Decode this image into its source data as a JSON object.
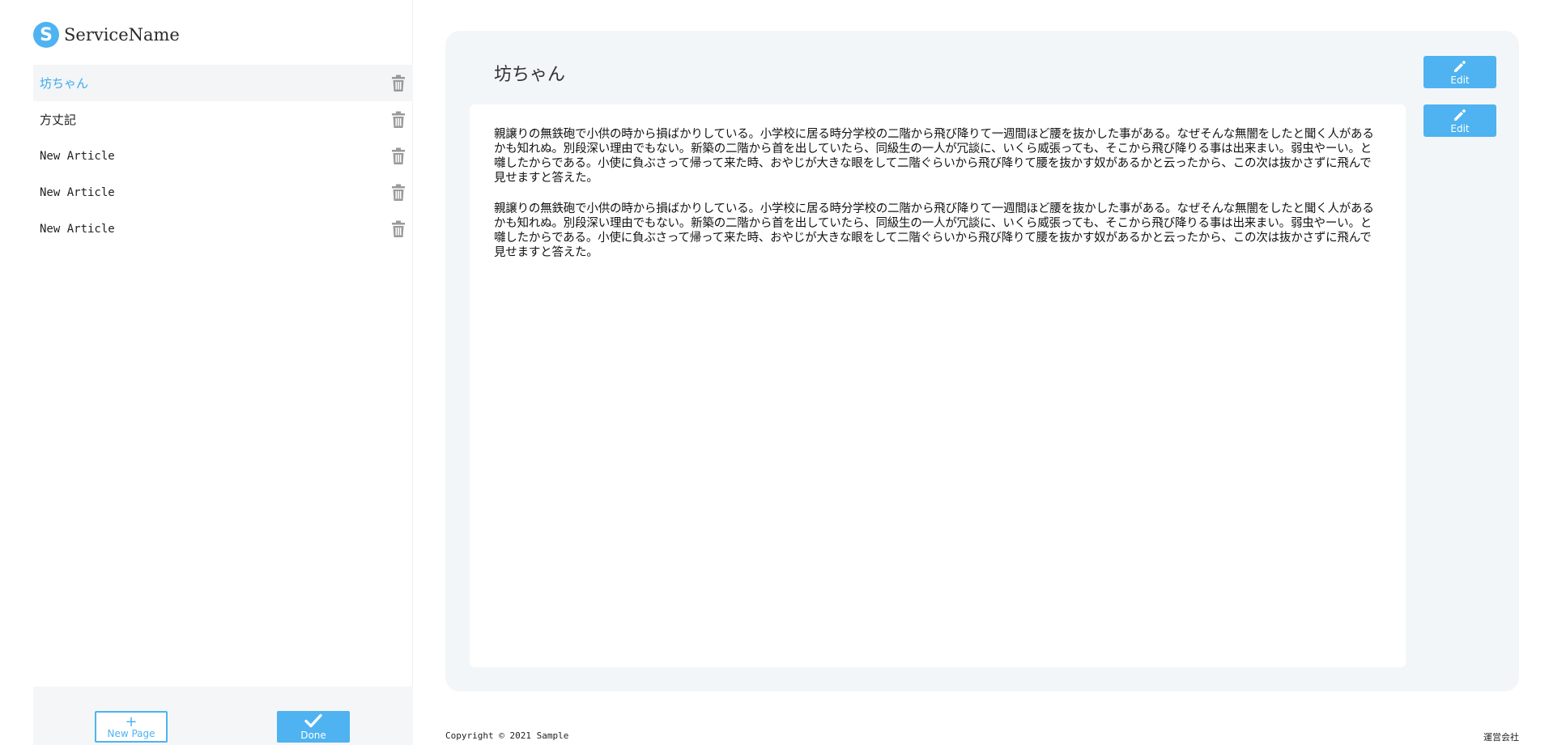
{
  "brand": {
    "logo_letter": "S",
    "name": "ServiceName"
  },
  "sidebar": {
    "items": [
      {
        "label": "坊ちゃん",
        "active": true
      },
      {
        "label": "方丈記",
        "active": false
      },
      {
        "label": "New Article",
        "active": false
      },
      {
        "label": "New Article",
        "active": false
      },
      {
        "label": "New Article",
        "active": false
      }
    ],
    "new_page_label": "New Page",
    "new_page_symbol": "+",
    "done_label": "Done"
  },
  "article": {
    "title": "坊ちゃん",
    "paragraphs": [
      "親譲りの無鉄砲で小供の時から損ばかりしている。小学校に居る時分学校の二階から飛び降りて一週間ほど腰を抜かした事がある。なぜそんな無闇をしたと聞く人があるかも知れぬ。別段深い理由でもない。新築の二階から首を出していたら、同級生の一人が冗談に、いくら威張っても、そこから飛び降りる事は出来まい。弱虫やーい。と囃したからである。小使に負ぶさって帰って来た時、おやじが大きな眼をして二階ぐらいから飛び降りて腰を抜かす奴があるかと云ったから、この次は抜かさずに飛んで見せますと答えた。",
      "親譲りの無鉄砲で小供の時から損ばかりしている。小学校に居る時分学校の二階から飛び降りて一週間ほど腰を抜かした事がある。なぜそんな無闇をしたと聞く人があるかも知れぬ。別段深い理由でもない。新築の二階から首を出していたら、同級生の一人が冗談に、いくら威張っても、そこから飛び降りる事は出来まい。弱虫やーい。と囃したからである。小使に負ぶさって帰って来た時、おやじが大きな眼をして二階ぐらいから飛び降りて腰を抜かす奴があるかと云ったから、この次は抜かさずに飛んで見せますと答えた。"
    ],
    "edit_label": "Edit"
  },
  "footer": {
    "copyright": "Copyright © 2021 Sample",
    "company": "運営会社"
  },
  "colors": {
    "accent": "#4eb3f0",
    "panel_bg": "#f3f6f9",
    "active_item_bg": "#f3f5f7",
    "trash": "#9a9a9a"
  },
  "icons": {
    "logo": "s-logo-icon",
    "delete": "trash-icon",
    "edit": "pencil-icon",
    "done": "check-icon",
    "new_page": "plus-icon"
  }
}
